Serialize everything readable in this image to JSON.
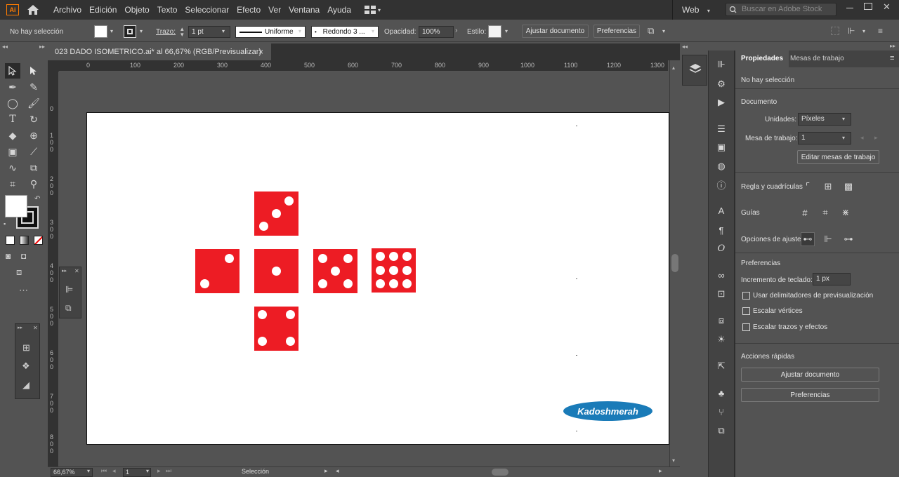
{
  "app": {
    "logo": "Ai",
    "home_icon": "home-icon"
  },
  "menu": [
    "Archivo",
    "Edición",
    "Objeto",
    "Texto",
    "Seleccionar",
    "Efecto",
    "Ver",
    "Ventana",
    "Ayuda"
  ],
  "workspace": {
    "label": "Web"
  },
  "search": {
    "placeholder": "Buscar en Adobe Stock"
  },
  "control": {
    "selection_status": "No hay selección",
    "stroke_label": "Trazo:",
    "stroke_value": "1 pt",
    "stroke_style": "Uniforme",
    "brush": "Redondo 3 ...",
    "opacity_label": "Opacidad:",
    "opacity_value": "100%",
    "style_label": "Estilo:",
    "adjust_doc": "Ajustar documento",
    "preferences": "Preferencias"
  },
  "document": {
    "tab_title": "023 DADO ISOMETRICO.ai* al 66,67% (RGB/Previsualizar)",
    "close": "×"
  },
  "ruler": {
    "top": [
      "0",
      "100",
      "200",
      "300",
      "400",
      "500",
      "600",
      "700",
      "800",
      "900",
      "1000",
      "1100",
      "1200",
      "1300"
    ],
    "left": [
      "0",
      "100",
      "200",
      "300",
      "400",
      "500",
      "600",
      "700",
      "800"
    ]
  },
  "artwork": {
    "die_color": "#ed1c24",
    "dice": [
      {
        "name": "die-three",
        "face_value": 3
      },
      {
        "name": "die-two",
        "face_value": 2
      },
      {
        "name": "die-one",
        "face_value": 1
      },
      {
        "name": "die-five",
        "face_value": 5
      },
      {
        "name": "die-nine",
        "face_value": 9
      },
      {
        "name": "die-four",
        "face_value": 4
      }
    ],
    "watermark": "Kadoshmerah",
    "watermark_color": "#1a7bb8"
  },
  "properties": {
    "tabs": [
      "Propiedades",
      "Mesas de trabajo"
    ],
    "no_selection": "No hay selección",
    "document_title": "Documento",
    "units_label": "Unidades:",
    "units_value": "Píxeles",
    "artboard_label": "Mesa de trabajo:",
    "artboard_value": "1",
    "edit_artboards": "Editar mesas de trabajo",
    "rulers_label": "Regla y cuadrículas",
    "guides_label": "Guías",
    "snap_label": "Opciones de ajuste",
    "prefs_title": "Preferencias",
    "keyboard_inc_label": "Incremento de teclado:",
    "keyboard_inc_value": "1 px",
    "checkboxes": [
      "Usar delimitadores de previsualización",
      "Escalar vértices",
      "Escalar trazos y efectos"
    ],
    "quick_actions_title": "Acciones rápidas",
    "qa_adjust": "Ajustar documento",
    "qa_prefs": "Preferencias"
  },
  "status": {
    "zoom": "66,67%",
    "artboard": "1",
    "tool": "Selección"
  }
}
